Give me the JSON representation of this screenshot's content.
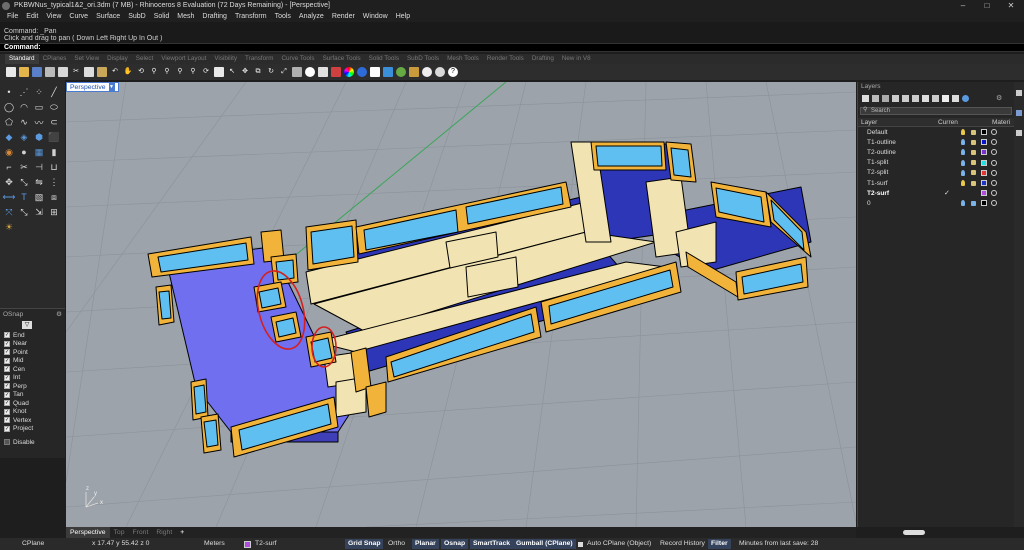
{
  "window": {
    "title": "PKBWNus_typical1&2_ori.3dm (7 MB) - Rhinoceros 8 Evaluation (72 Days Remaining) - [Perspective]",
    "minimize": "–",
    "maximize": "□",
    "close": "✕"
  },
  "menu": [
    "File",
    "Edit",
    "View",
    "Curve",
    "Surface",
    "SubD",
    "Solid",
    "Mesh",
    "Drafting",
    "Transform",
    "Tools",
    "Analyze",
    "Render",
    "Window",
    "Help"
  ],
  "command_history": [
    "Command: _Pan",
    "Click and drag to pan ( Down  Left  Right  Up  In  Out )"
  ],
  "command_prompt": "Command:",
  "toolbar_tabs": [
    "Standard",
    "CPlanes",
    "Set View",
    "Display",
    "Select",
    "Viewport Layout",
    "Visibility",
    "Transform",
    "Curve Tools",
    "Surface Tools",
    "Solid Tools",
    "SubD Tools",
    "Mesh Tools",
    "Render Tools",
    "Drafting",
    "New in V8"
  ],
  "viewport": {
    "tab_label": "Perspective",
    "axis_labels": {
      "x": "x",
      "y": "y",
      "z": "z"
    }
  },
  "osnap": {
    "title": "OSnap",
    "items": [
      {
        "label": "End",
        "checked": true
      },
      {
        "label": "Near",
        "checked": true
      },
      {
        "label": "Point",
        "checked": true
      },
      {
        "label": "Mid",
        "checked": true
      },
      {
        "label": "Cen",
        "checked": true
      },
      {
        "label": "Int",
        "checked": true
      },
      {
        "label": "Perp",
        "checked": true
      },
      {
        "label": "Tan",
        "checked": true
      },
      {
        "label": "Quad",
        "checked": true
      },
      {
        "label": "Knot",
        "checked": true
      },
      {
        "label": "Vertex",
        "checked": true
      },
      {
        "label": "Project",
        "checked": true
      }
    ],
    "disable": "Disable"
  },
  "layers": {
    "title": "Layers",
    "search_placeholder": "Search",
    "columns": {
      "layer": "Layer",
      "current": "Curren",
      "material": "Materi"
    },
    "rows": [
      {
        "name": "Default",
        "color": "#000000",
        "current": false,
        "bulb": "#e8c84a",
        "bold": false
      },
      {
        "name": "T1-outline",
        "color": "#0a14c8",
        "current": false,
        "bulb": "#7ab3e8",
        "bold": false
      },
      {
        "name": "T2-outline",
        "color": "#7a2fd0",
        "current": false,
        "bulb": "#7ab3e8",
        "bold": false
      },
      {
        "name": "T1-split",
        "color": "#1fe0e0",
        "current": false,
        "bulb": "#7ab3e8",
        "bold": false
      },
      {
        "name": "T2-split",
        "color": "#e23535",
        "current": false,
        "bulb": "#7ab3e8",
        "bold": false
      },
      {
        "name": "T1-surf",
        "color": "#1f34c8",
        "current": false,
        "bulb": "#e8c84a",
        "bold": false
      },
      {
        "name": "T2-surf",
        "color": "#b04be0",
        "current": true,
        "bulb": "",
        "bold": true
      },
      {
        "name": "0",
        "color": "#000000",
        "current": false,
        "bulb": "#7ab3e8",
        "bold": false
      }
    ]
  },
  "view_tabs": [
    "Perspective",
    "Top",
    "Front",
    "Right",
    "+"
  ],
  "status": {
    "cplane": "CPlane",
    "coords": "x 17.47  y 55.42  z 0",
    "units": "Meters",
    "layer": "T2-surf",
    "layer_color": "#b04be0",
    "grid_snap": "Grid Snap",
    "ortho": "Ortho",
    "planar": "Planar",
    "osnap": "Osnap",
    "smarttrack": "SmartTrack",
    "gumball": "Gumball (CPlane)",
    "auto_cplane": "Auto CPlane (Object)",
    "record_history": "Record History",
    "filter": "Filter",
    "minutes": "Minutes from last save: 28"
  }
}
